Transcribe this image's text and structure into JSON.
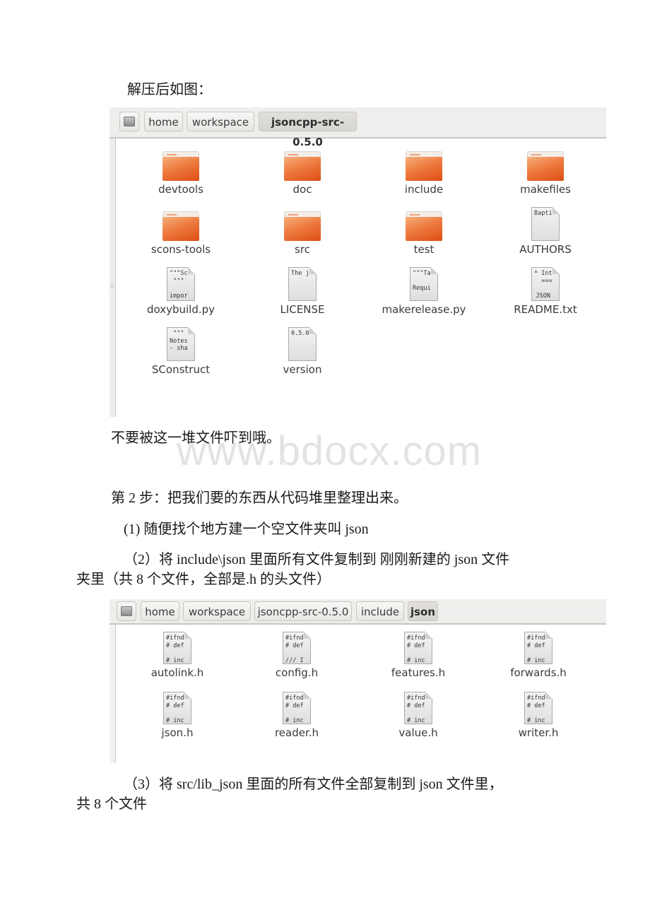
{
  "paragraphs": {
    "p1": "解压后如图：",
    "p2": "不要被这一堆文件吓到哦。",
    "p3": "第 2 步：把我们要的东西从代码堆里整理出来。",
    "p4": "(1) 随便找个地方建一个空文件夹叫 json",
    "p5a": "（2）将 include\\json 里面所有文件复制到 刚刚新建的 json 文件",
    "p5b": "夹里（共 8 个文件，全部是.h 的头文件）",
    "p6a": "（3）将 src/lib_json 里面的所有文件全部复制到 json 文件里，",
    "p6b": "共 8 个文件"
  },
  "watermark": "www.bdocx.com",
  "screenshot1": {
    "breadcrumb": [
      "home",
      "workspace",
      "jsoncpp-src-0.5.0"
    ],
    "drive_icon": "drive-icon",
    "items": [
      {
        "name": "devtools",
        "type": "folder"
      },
      {
        "name": "doc",
        "type": "folder"
      },
      {
        "name": "include",
        "type": "folder"
      },
      {
        "name": "makefiles",
        "type": "folder"
      },
      {
        "name": "scons-tools",
        "type": "folder"
      },
      {
        "name": "src",
        "type": "folder"
      },
      {
        "name": "test",
        "type": "folder"
      },
      {
        "name": "AUTHORS",
        "type": "file",
        "preview": "Bapti"
      },
      {
        "name": "doxybuild.py",
        "type": "file",
        "preview": "\"\"\"Sc\n\"\"\"\n\nimpor"
      },
      {
        "name": "LICENSE",
        "type": "file",
        "preview": "The j"
      },
      {
        "name": "makerelease.py",
        "type": "file",
        "preview": "\"\"\"Ta\n\nRequi"
      },
      {
        "name": "README.txt",
        "type": "file",
        "preview": "* Int\n  ===\n\nJSON"
      },
      {
        "name": "SConstruct",
        "type": "file",
        "preview": "\"\"\"\nNotes\n- sha"
      },
      {
        "name": "version",
        "type": "file",
        "preview": "0.5.0"
      }
    ]
  },
  "screenshot2": {
    "breadcrumb": [
      "home",
      "workspace",
      "jsoncpp-src-0.5.0",
      "include",
      "json"
    ],
    "items": [
      {
        "name": "autolink.h",
        "preview": "#ifnd\n# def\n\n# inc"
      },
      {
        "name": "config.h",
        "preview": "#ifnd\n# def\n\n/// I"
      },
      {
        "name": "features.h",
        "preview": "#ifnd\n# def\n\n# inc"
      },
      {
        "name": "forwards.h",
        "preview": "#ifnd\n# def\n\n# inc"
      },
      {
        "name": "json.h",
        "preview": "#ifnd\n# def\n\n# inc"
      },
      {
        "name": "reader.h",
        "preview": "#ifnd\n# def\n\n# inc"
      },
      {
        "name": "value.h",
        "preview": "#ifnd\n# def\n\n# inc"
      },
      {
        "name": "writer.h",
        "preview": "#ifnd\n# def\n\n# inc"
      }
    ]
  }
}
